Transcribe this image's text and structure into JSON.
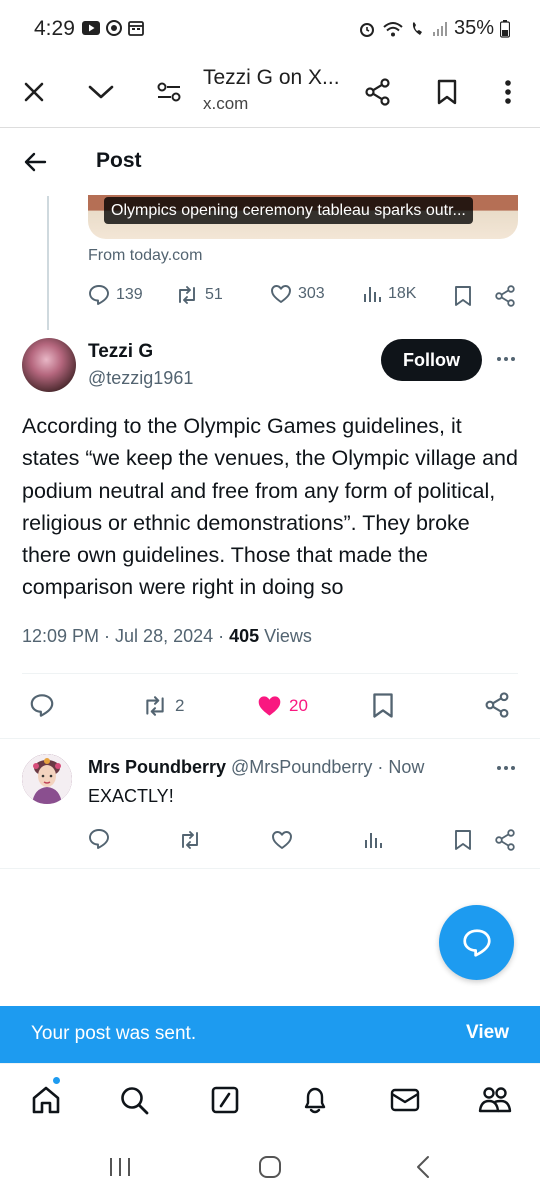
{
  "status_bar": {
    "time": "4:29",
    "battery": "35%"
  },
  "browser": {
    "title": "Tezzi G on X...",
    "domain": "x.com"
  },
  "header": {
    "title": "Post"
  },
  "quoted_card": {
    "caption": "Olympics opening ceremony tableau sparks outr...",
    "source": "From today.com",
    "replies": "139",
    "reposts": "51",
    "likes": "303",
    "views": "18K"
  },
  "tweet": {
    "author_name": "Tezzi G",
    "author_handle": "@tezzig1961",
    "follow_label": "Follow",
    "text": "According to the Olympic Games guidelines, it states “we keep the venues, the Olympic village and podium neutral and free from any form of political, religious or ethnic demonstrations”. They broke there own guidelines. Those that made the comparison were right in doing so",
    "time": "12:09 PM · Jul 28, 2024 · ",
    "views_count": "405",
    "views_label": " Views",
    "reposts": "2",
    "likes": "20",
    "like_color": "#f91880"
  },
  "reply": {
    "author_name": "Mrs Poundberry",
    "author_handle": " @MrsPoundberry · Now",
    "text": "EXACTLY!"
  },
  "toast": {
    "message": "Your post was sent.",
    "action": "View"
  },
  "colors": {
    "accent": "#1d9bf0",
    "secondary_text": "#536471"
  }
}
